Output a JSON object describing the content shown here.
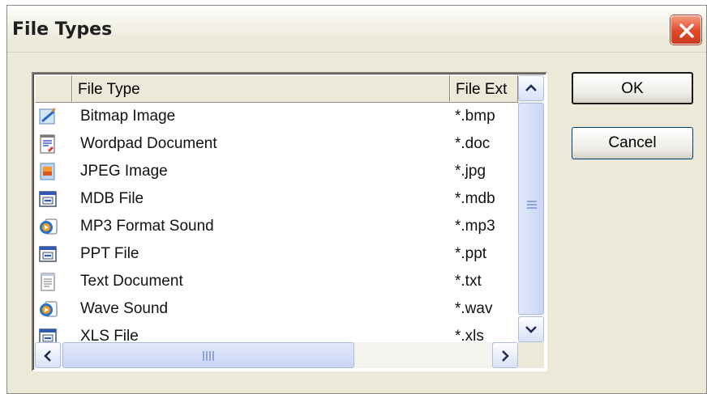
{
  "window": {
    "title": "File Types"
  },
  "list": {
    "columns": [
      "File Type",
      "File Ext"
    ],
    "rows": [
      {
        "type": "Bitmap Image",
        "ext": "*.bmp",
        "icon": "bitmap-icon"
      },
      {
        "type": "Wordpad Document",
        "ext": "*.doc",
        "icon": "wordpad-icon"
      },
      {
        "type": "JPEG Image",
        "ext": "*.jpg",
        "icon": "jpeg-icon"
      },
      {
        "type": "MDB File",
        "ext": "*.mdb",
        "icon": "generic-app-icon"
      },
      {
        "type": "MP3 Format Sound",
        "ext": "*.mp3",
        "icon": "media-player-icon"
      },
      {
        "type": "PPT File",
        "ext": "*.ppt",
        "icon": "generic-app-icon"
      },
      {
        "type": "Text Document",
        "ext": "*.txt",
        "icon": "notepad-icon"
      },
      {
        "type": "Wave Sound",
        "ext": "*.wav",
        "icon": "media-player-icon"
      },
      {
        "type": "XLS File",
        "ext": "*.xls",
        "icon": "generic-app-icon"
      }
    ]
  },
  "buttons": {
    "ok": "OK",
    "cancel": "Cancel"
  },
  "colors": {
    "dialog_bg": "#ece9d8",
    "close_red": "#e04a2b",
    "scroll_blue": "#c9d6f6"
  }
}
